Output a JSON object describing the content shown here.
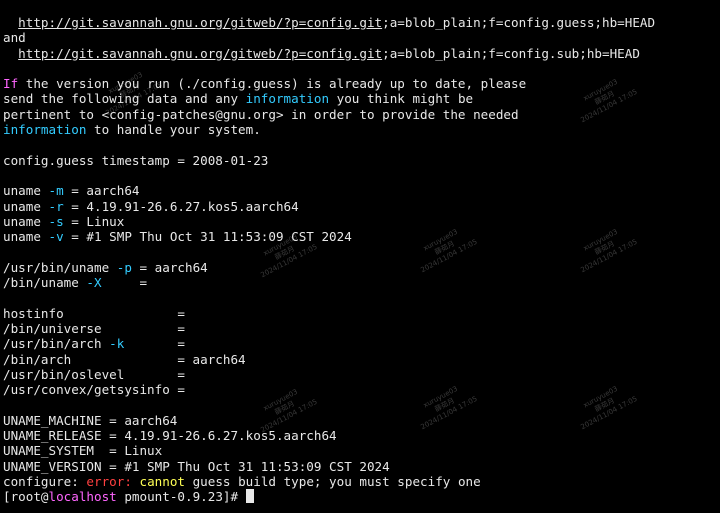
{
  "terminal": {
    "lines": [
      {
        "segments": [
          {
            "text": "  "
          },
          {
            "text": "http://git.savannah.gnu.org/gitweb/?p=config.git",
            "cls": "url"
          },
          {
            "text": ";a=blob_plain;f=config.guess;hb=HEAD"
          }
        ]
      },
      {
        "segments": [
          {
            "text": "and"
          }
        ]
      },
      {
        "segments": [
          {
            "text": "  "
          },
          {
            "text": "http://git.savannah.gnu.org/gitweb/?p=config.git",
            "cls": "url"
          },
          {
            "text": ";a=blob_plain;f=config.sub;hb=HEAD"
          }
        ]
      },
      {
        "segments": [
          {
            "text": ""
          }
        ]
      },
      {
        "segments": [
          {
            "text": "If",
            "cls": "c-ident"
          },
          {
            "text": " the version you run (./config.guess) is already up to date, please"
          }
        ]
      },
      {
        "segments": [
          {
            "text": "send the following data and any "
          },
          {
            "text": "information",
            "cls": "c-blue"
          },
          {
            "text": " you think might be"
          }
        ]
      },
      {
        "segments": [
          {
            "text": "pertinent to <config-patches@gnu.org> in order to provide the needed"
          }
        ]
      },
      {
        "segments": [
          {
            "text": "information",
            "cls": "c-blue"
          },
          {
            "text": " to handle your system."
          }
        ]
      },
      {
        "segments": [
          {
            "text": ""
          }
        ]
      },
      {
        "segments": [
          {
            "text": "config.guess timestamp = 2008-01-23"
          }
        ]
      },
      {
        "segments": [
          {
            "text": ""
          }
        ]
      },
      {
        "segments": [
          {
            "text": "uname "
          },
          {
            "text": "-m",
            "cls": "c-blue"
          },
          {
            "text": " = aarch64"
          }
        ]
      },
      {
        "segments": [
          {
            "text": "uname "
          },
          {
            "text": "-r",
            "cls": "c-blue"
          },
          {
            "text": " = 4.19.91-26.6.27.kos5.aarch64"
          }
        ]
      },
      {
        "segments": [
          {
            "text": "uname "
          },
          {
            "text": "-s",
            "cls": "c-blue"
          },
          {
            "text": " = Linux"
          }
        ]
      },
      {
        "segments": [
          {
            "text": "uname "
          },
          {
            "text": "-v",
            "cls": "c-blue"
          },
          {
            "text": " = #1 SMP Thu Oct 31 11:53:09 CST 2024"
          }
        ]
      },
      {
        "segments": [
          {
            "text": ""
          }
        ]
      },
      {
        "segments": [
          {
            "text": "/usr/bin/uname "
          },
          {
            "text": "-p",
            "cls": "c-blue"
          },
          {
            "text": " = aarch64"
          }
        ]
      },
      {
        "segments": [
          {
            "text": "/bin/uname "
          },
          {
            "text": "-X",
            "cls": "c-blue"
          },
          {
            "text": "     ="
          }
        ]
      },
      {
        "segments": [
          {
            "text": ""
          }
        ]
      },
      {
        "segments": [
          {
            "text": "hostinfo               ="
          }
        ]
      },
      {
        "segments": [
          {
            "text": "/bin/universe          ="
          }
        ]
      },
      {
        "segments": [
          {
            "text": "/usr/bin/arch "
          },
          {
            "text": "-k",
            "cls": "c-blue"
          },
          {
            "text": "       ="
          }
        ]
      },
      {
        "segments": [
          {
            "text": "/bin/arch              = aarch64"
          }
        ]
      },
      {
        "segments": [
          {
            "text": "/usr/bin/oslevel       ="
          }
        ]
      },
      {
        "segments": [
          {
            "text": "/usr/convex/getsysinfo ="
          }
        ]
      },
      {
        "segments": [
          {
            "text": ""
          }
        ]
      },
      {
        "segments": [
          {
            "text": "UNAME_MACHINE = aarch64"
          }
        ]
      },
      {
        "segments": [
          {
            "text": "UNAME_RELEASE = 4.19.91-26.6.27.kos5.aarch64"
          }
        ]
      },
      {
        "segments": [
          {
            "text": "UNAME_SYSTEM  = Linux"
          }
        ]
      },
      {
        "segments": [
          {
            "text": "UNAME_VERSION = #1 SMP Thu Oct 31 11:53:09 CST 2024"
          }
        ]
      },
      {
        "segments": [
          {
            "text": "configure: "
          },
          {
            "text": "error:",
            "cls": "c-red"
          },
          {
            "text": " "
          },
          {
            "text": "cannot",
            "cls": "c-yellow"
          },
          {
            "text": " guess build type; you must specify one"
          }
        ]
      },
      {
        "segments": [
          {
            "text": "[root@"
          },
          {
            "text": "localhost",
            "cls": "c-host"
          },
          {
            "text": " pmount-0.9.23]# "
          }
        ],
        "cursor": true
      }
    ]
  },
  "watermark": {
    "lines": [
      "xuruyue03",
      "薛茹月",
      "2024/11/04 17:05"
    ]
  },
  "colors": {
    "background": "#000000",
    "foreground": "#e8e8e8",
    "option_blue": "#33ccff",
    "error_red": "#ff4040",
    "warning_yellow": "#ffff55",
    "host_magenta": "#ff66ff"
  }
}
